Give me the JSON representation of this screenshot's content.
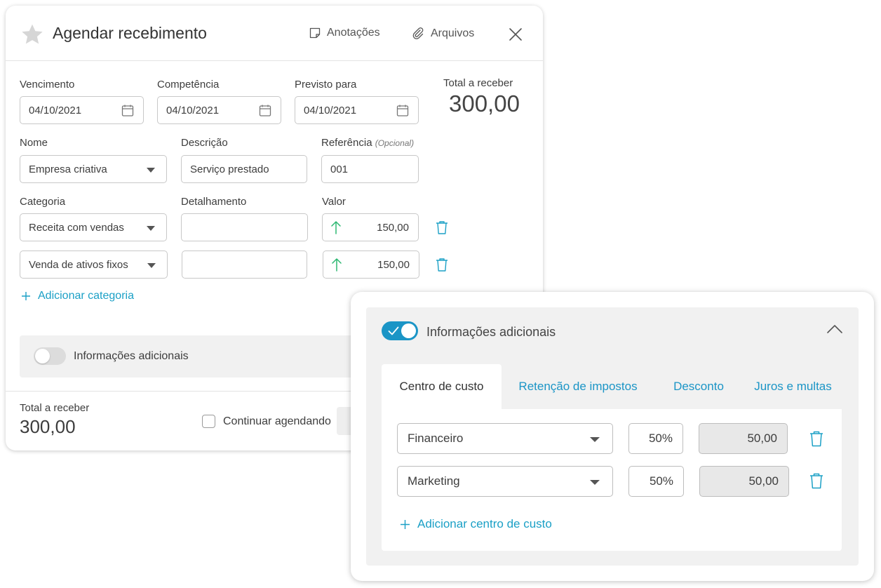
{
  "modal": {
    "title": "Agendar recebimento",
    "actions": {
      "notes": "Anotações",
      "files": "Arquivos"
    },
    "fields": {
      "vencimento": {
        "label": "Vencimento",
        "value": "04/10/2021"
      },
      "competencia": {
        "label": "Competência",
        "value": "04/10/2021"
      },
      "previsto": {
        "label": "Previsto para",
        "value": "04/10/2021"
      },
      "nome": {
        "label": "Nome",
        "value": "Empresa criativa"
      },
      "descricao": {
        "label": "Descrição",
        "value": "Serviço prestado"
      },
      "referencia": {
        "label": "Referência",
        "optional": "(Opcional)",
        "value": "001"
      },
      "categoria_label": "Categoria",
      "detalhamento_label": "Detalhamento",
      "valor_label": "Valor"
    },
    "total": {
      "label": "Total a receber",
      "value": "300,00"
    },
    "categories": [
      {
        "category": "Receita com vendas",
        "detail": "",
        "value": "150,00"
      },
      {
        "category": "Venda de ativos fixos",
        "detail": "",
        "value": "150,00"
      }
    ],
    "add_category": "Adicionar categoria",
    "info_toggle_label": "Informações adicionais",
    "footer": {
      "total_label": "Total a receber",
      "total_value": "300,00",
      "continue_label": "Continuar agendando"
    }
  },
  "panel": {
    "toggle_label": "Informações adicionais",
    "tabs": [
      "Centro de custo",
      "Retenção de impostos",
      "Desconto",
      "Juros e multas"
    ],
    "active_tab": 0,
    "cost_centers": [
      {
        "name": "Financeiro",
        "percent": "50%",
        "value": "50,00"
      },
      {
        "name": "Marketing",
        "percent": "50%",
        "value": "50,00"
      }
    ],
    "add_cost_center": "Adicionar centro de custo"
  },
  "colors": {
    "accent": "#1b95c6",
    "up_arrow": "#2eb872",
    "link": "#1ba0c6"
  }
}
